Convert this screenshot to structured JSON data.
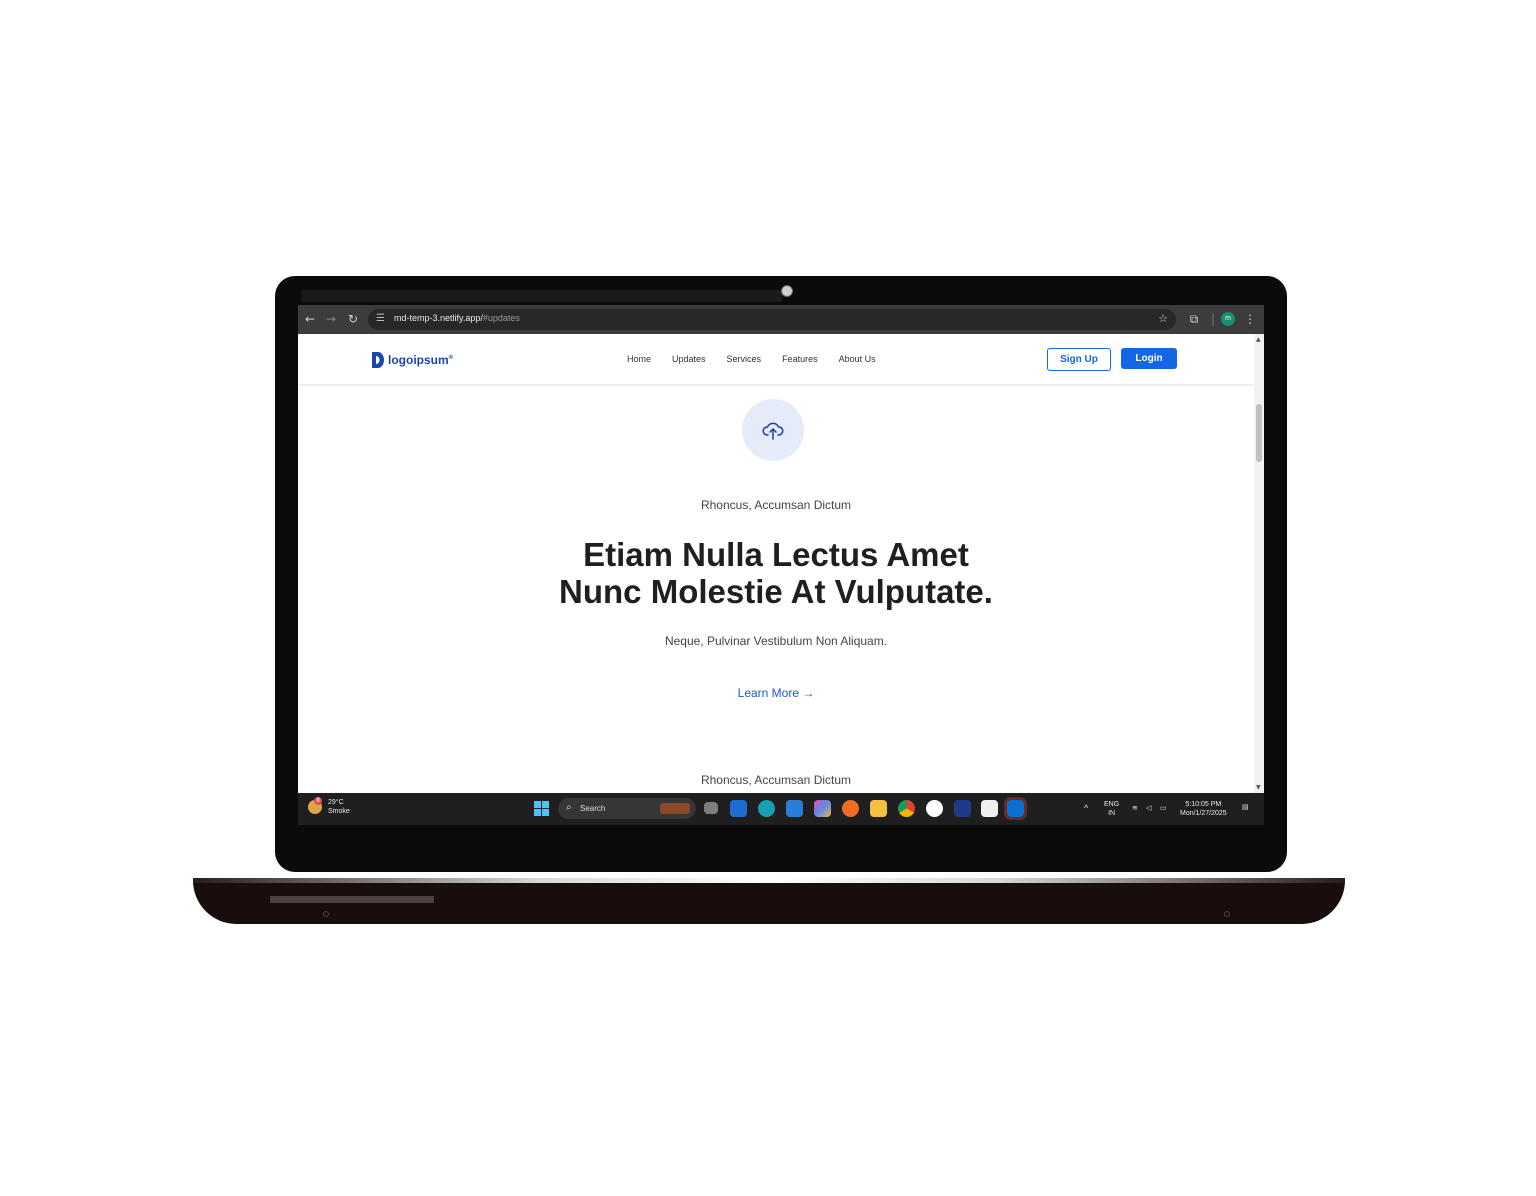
{
  "browser": {
    "url_host": "md-temp-3.netlify.app/",
    "url_path": "#updates",
    "profile_initial": "m"
  },
  "site": {
    "logo_text": "logoipsum",
    "logo_mark_sup": "®",
    "nav": [
      "Home",
      "Updates",
      "Services",
      "Features",
      "About Us"
    ],
    "signup_label": "Sign Up",
    "login_label": "Login",
    "eyebrow": "Rhoncus, Accumsan Dictum",
    "headline_line1": "Etiam Nulla Lectus Amet",
    "headline_line2": "Nunc Molestie At Vulputate.",
    "subtitle": "Neque, Pulvinar Vestibulum Non Aliquam.",
    "learn_more": "Learn More →",
    "eyebrow_2": "Rhoncus, Accumsan Dictum",
    "accent_color": "#1565e8"
  },
  "taskbar": {
    "weather_temp": "29°C",
    "weather_desc": "Smoke",
    "weather_badge": "8",
    "search_label": "Search",
    "language": "ENG",
    "region": "IN",
    "time": "5:10:05 PM",
    "date": "Mon/1/27/2025"
  }
}
